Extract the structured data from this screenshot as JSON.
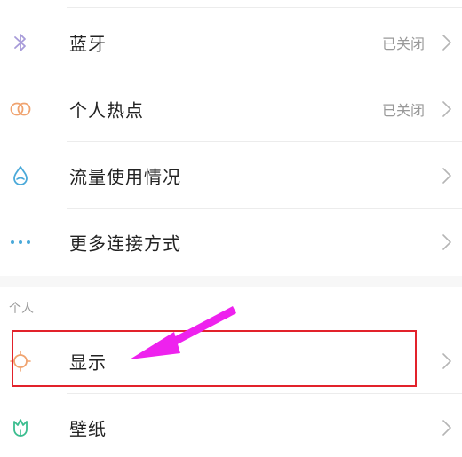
{
  "settings": {
    "rows": [
      {
        "key": "bluetooth",
        "label": "蓝牙",
        "status": "已关闭",
        "icon": "bluetooth-icon"
      },
      {
        "key": "hotspot",
        "label": "个人热点",
        "status": "已关闭",
        "icon": "hotspot-icon"
      },
      {
        "key": "data-usage",
        "label": "流量使用情况",
        "status": "",
        "icon": "water-drop-icon"
      },
      {
        "key": "more-connections",
        "label": "更多连接方式",
        "status": "",
        "icon": "more-dots-icon"
      }
    ],
    "personal_section": {
      "title": "个人",
      "rows": [
        {
          "key": "display",
          "label": "显示",
          "icon": "sun-icon"
        },
        {
          "key": "wallpaper",
          "label": "壁纸",
          "icon": "tulip-icon"
        }
      ]
    }
  },
  "annotation": {
    "highlight_color": "#e2222b",
    "arrow_color": "#ee22ee"
  },
  "colors": {
    "bluetooth": "#a79bd9",
    "hotspot": "#f0a36f",
    "data_usage": "#4aa9d9",
    "more": "#4aa9d9",
    "display": "#f0a36f",
    "wallpaper": "#3bbd8f"
  }
}
